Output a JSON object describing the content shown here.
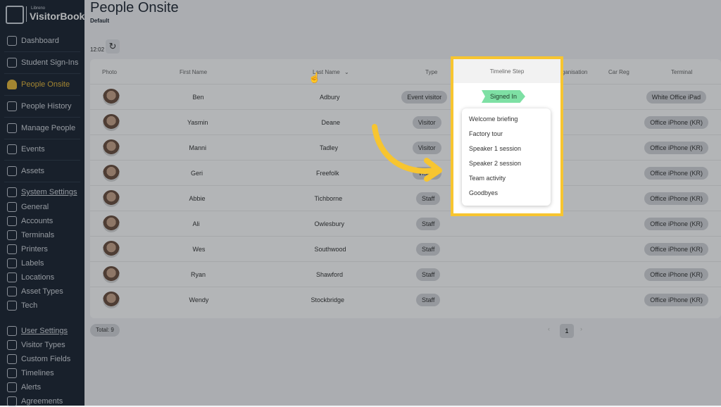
{
  "app": {
    "logo_small": "Libreno",
    "logo_name": "VisitorBook"
  },
  "sidebar": {
    "items": [
      {
        "label": "Dashboard",
        "icon": "dashboard-icon"
      },
      {
        "label": "Student Sign-Ins",
        "icon": "student-icon"
      },
      {
        "label": "People Onsite",
        "icon": "people-icon",
        "active": true
      },
      {
        "label": "People History",
        "icon": "history-icon"
      },
      {
        "label": "Manage People",
        "icon": "id-card-icon"
      },
      {
        "label": "Events",
        "icon": "calendar-icon"
      },
      {
        "label": "Assets",
        "icon": "assets-icon"
      }
    ],
    "system_section": "System Settings",
    "system_items": [
      {
        "label": "General",
        "icon": "edit-icon"
      },
      {
        "label": "Accounts",
        "icon": "users-icon"
      },
      {
        "label": "Terminals",
        "icon": "terminal-icon"
      },
      {
        "label": "Printers",
        "icon": "printer-icon"
      },
      {
        "label": "Labels",
        "icon": "label-icon"
      },
      {
        "label": "Locations",
        "icon": "location-icon"
      },
      {
        "label": "Asset Types",
        "icon": "box-icon"
      },
      {
        "label": "Tech",
        "icon": "tools-icon"
      }
    ],
    "user_section": "User Settings",
    "user_items": [
      {
        "label": "Visitor Types",
        "icon": "visitor-types-icon"
      },
      {
        "label": "Custom Fields",
        "icon": "fields-icon"
      },
      {
        "label": "Timelines",
        "icon": "timeline-icon"
      },
      {
        "label": "Alerts",
        "icon": "megaphone-icon"
      },
      {
        "label": "Agreements",
        "icon": "agreement-icon"
      }
    ]
  },
  "page": {
    "title": "People Onsite",
    "subtitle": "Default",
    "clock": "12:02"
  },
  "table": {
    "headers": {
      "photo": "Photo",
      "first_name": "First Name",
      "last_name": "Last Name",
      "type": "Type",
      "timeline_step": "Timeline Step",
      "organisation": "Organisation",
      "car_reg": "Car Reg",
      "terminal": "Terminal"
    },
    "rows": [
      {
        "first": "Ben",
        "last": "Adbury",
        "type": "Event visitor",
        "terminal": "White Office iPad"
      },
      {
        "first": "Yasmin",
        "last": "Deane",
        "type": "Visitor",
        "terminal": "Office iPhone (KR)"
      },
      {
        "first": "Manni",
        "last": "Tadley",
        "type": "Visitor",
        "terminal": "Office iPhone (KR)"
      },
      {
        "first": "Geri",
        "last": "Freefolk",
        "type": "Visitor",
        "terminal": "Office iPhone (KR)"
      },
      {
        "first": "Abbie",
        "last": "Tichborne",
        "type": "Staff",
        "terminal": "Office iPhone (KR)"
      },
      {
        "first": "Ali",
        "last": "Owlesbury",
        "type": "Staff",
        "terminal": "Office iPhone (KR)"
      },
      {
        "first": "Wes",
        "last": "Southwood",
        "type": "Staff",
        "terminal": "Office iPhone (KR)"
      },
      {
        "first": "Ryan",
        "last": "Shawford",
        "type": "Staff",
        "terminal": "Office iPhone (KR)"
      },
      {
        "first": "Wendy",
        "last": "Stockbridge",
        "type": "Staff",
        "terminal": "Office iPhone (KR)"
      }
    ],
    "total": "Total: 9",
    "page_number": "1"
  },
  "timeline": {
    "current_step": "Signed In",
    "options": [
      "Welcome briefing",
      "Factory tour",
      "Speaker 1 session",
      "Speaker 2 session",
      "Team activity",
      "Goodbyes"
    ]
  },
  "colors": {
    "sidebar": "#1b2431",
    "highlight": "#f7c530",
    "active": "#e8b93a",
    "signed_in": "#7ee0a4"
  }
}
